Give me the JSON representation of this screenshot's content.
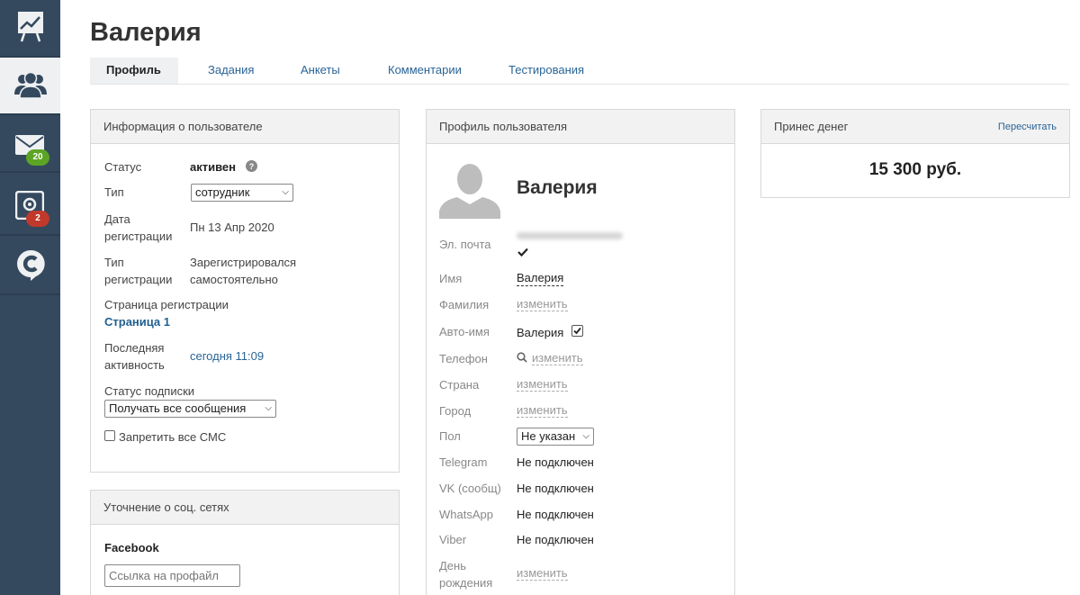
{
  "sidebar": {
    "items": [
      {
        "name": "analytics",
        "icon": "chart-board-icon"
      },
      {
        "name": "users",
        "icon": "users-icon"
      },
      {
        "name": "messages",
        "icon": "envelope-icon",
        "badge": "20",
        "badge_color": "#5ca524"
      },
      {
        "name": "settings",
        "icon": "gear-screen-icon",
        "badge": "2",
        "badge_color": "#c0392b"
      },
      {
        "name": "chat",
        "icon": "chat-logo-icon"
      }
    ]
  },
  "header": {
    "title": "Валерия",
    "tabs": [
      "Профиль",
      "Задания",
      "Анкеты",
      "Комментарии",
      "Тестирования"
    ]
  },
  "user_info": {
    "title": "Информация о пользователе",
    "status_label": "Статус",
    "status_value": "активен",
    "type_label": "Тип",
    "type_value": "сотрудник",
    "reg_date_label_1": "Дата",
    "reg_date_label_2": "регистрации",
    "reg_date_value": "Пн 13 Апр 2020",
    "reg_type_label_1": "Тип",
    "reg_type_label_2": "регистрации",
    "reg_type_value_1": "Зарегистрировался",
    "reg_type_value_2": "самостоятельно",
    "reg_page_label": "Страница регистрации",
    "reg_page_value": "Страница 1",
    "last_activity_label_1": "Последняя",
    "last_activity_label_2": "активность",
    "last_activity_value": "сегодня 11:09",
    "subscription_label": "Статус подписки",
    "subscription_value": "Получать все сообщения",
    "sms_label": "Запретить все СМС"
  },
  "social": {
    "title": "Уточнение о соц. сетях",
    "facebook_label": "Facebook",
    "facebook_placeholder": "Ссылка на профайл"
  },
  "profile": {
    "title": "Профиль пользователя",
    "name": "Валерия",
    "email_label": "Эл. почта",
    "first_name_label": "Имя",
    "first_name_value": "Валерия",
    "last_name_label": "Фамилия",
    "change": "изменить",
    "auto_name_label": "Авто-имя",
    "auto_name_value": "Валерия",
    "phone_label": "Телефон",
    "country_label": "Страна",
    "city_label": "Город",
    "gender_label": "Пол",
    "gender_value": "Не указан",
    "telegram_label": "Telegram",
    "vk_label": "VK (сообщ)",
    "whatsapp_label": "WhatsApp",
    "viber_label": "Viber",
    "not_connected": "Не подключен",
    "birthday_label_1": "День",
    "birthday_label_2": "рождения"
  },
  "money": {
    "title": "Принес денег",
    "recalc": "Пересчитать",
    "amount": "15 300 руб."
  }
}
